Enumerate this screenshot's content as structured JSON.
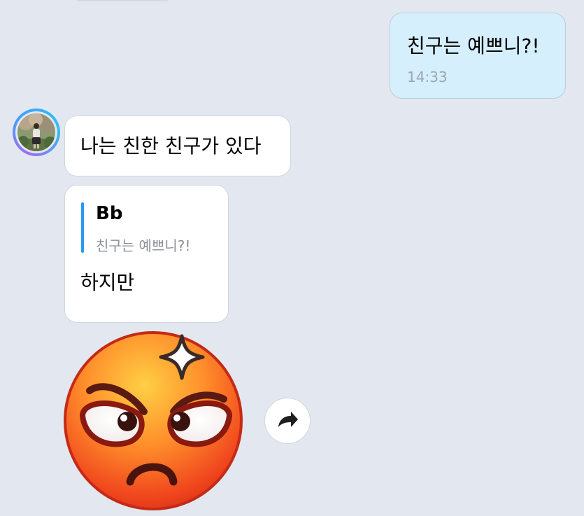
{
  "messages": {
    "outgoing_1": {
      "text": "친구는 예쁘니?!",
      "time": "14:33"
    },
    "incoming_1": {
      "text": "나는 친한 친구가 있다"
    },
    "incoming_reply": {
      "quote_author": "Bb",
      "quote_text": "친구는 예쁘니?!",
      "text": "하지만"
    },
    "sticker": {
      "name": "angry-face"
    }
  },
  "colors": {
    "background": "#e3e8f0",
    "outgoing_bubble": "#d5effc",
    "incoming_bubble": "#ffffff",
    "quote_accent": "#2a9af1"
  },
  "icons": {
    "forward": "forward-arrow-icon"
  }
}
